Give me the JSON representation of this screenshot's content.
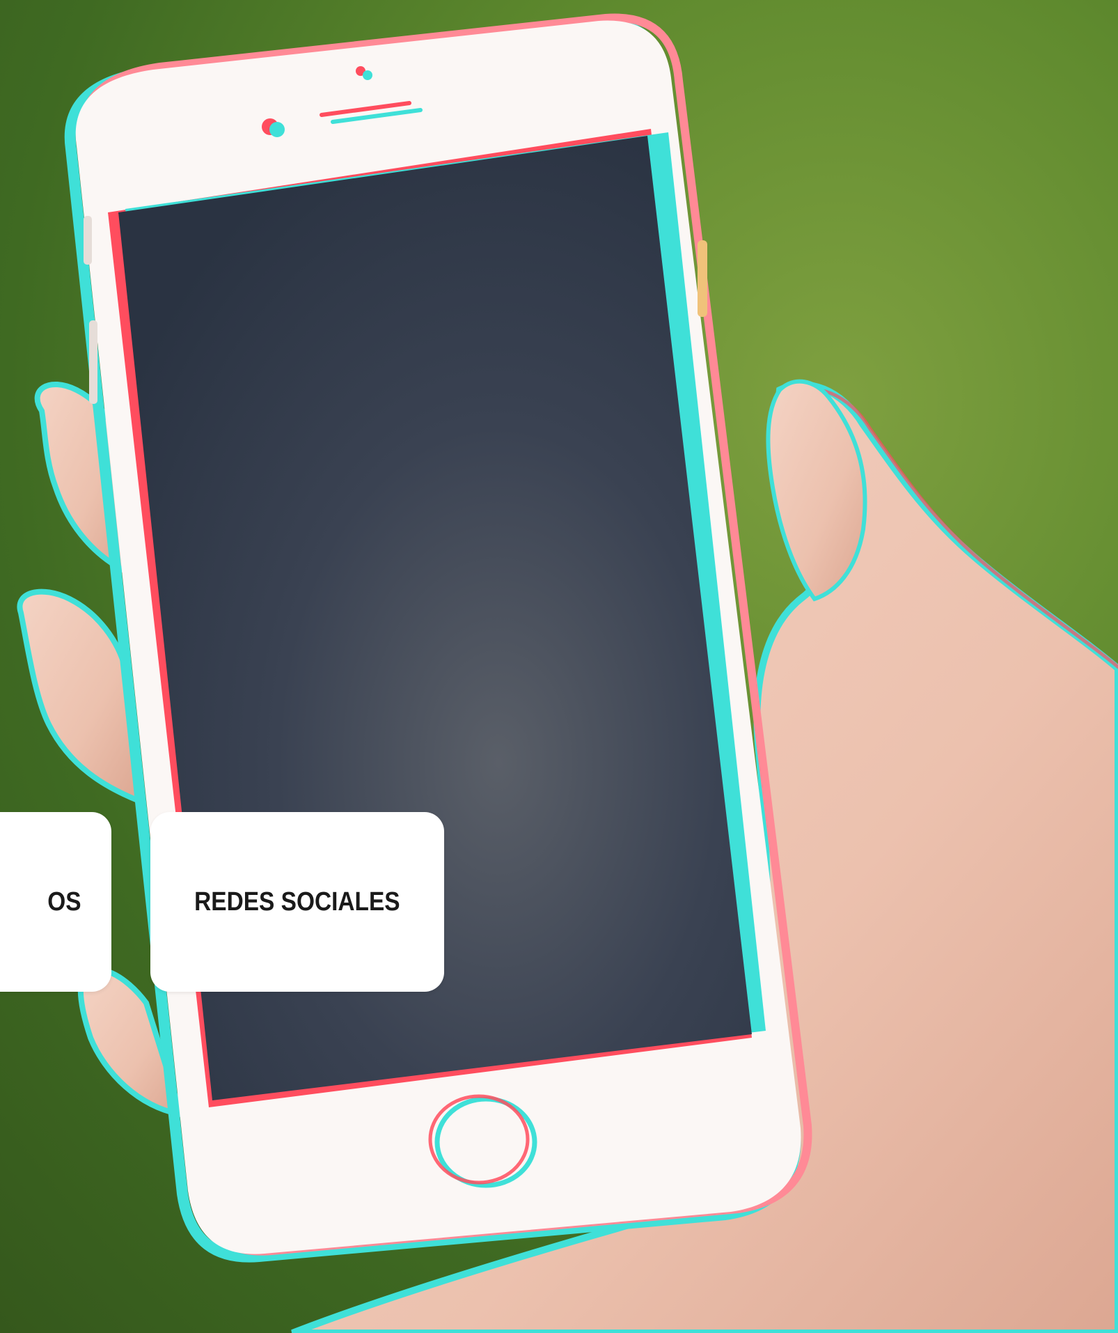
{
  "menu": {
    "items": [
      {
        "label": "OS"
      },
      {
        "label": "REDES SOCIALES"
      }
    ]
  },
  "colors": {
    "background_green": "#5f8a2e",
    "phone_body": "#fbf7f5",
    "screen": "#2c3646",
    "glitch_red": "#ff4d5e",
    "glitch_cyan": "#3fe0d8",
    "card": "#ffffff"
  }
}
